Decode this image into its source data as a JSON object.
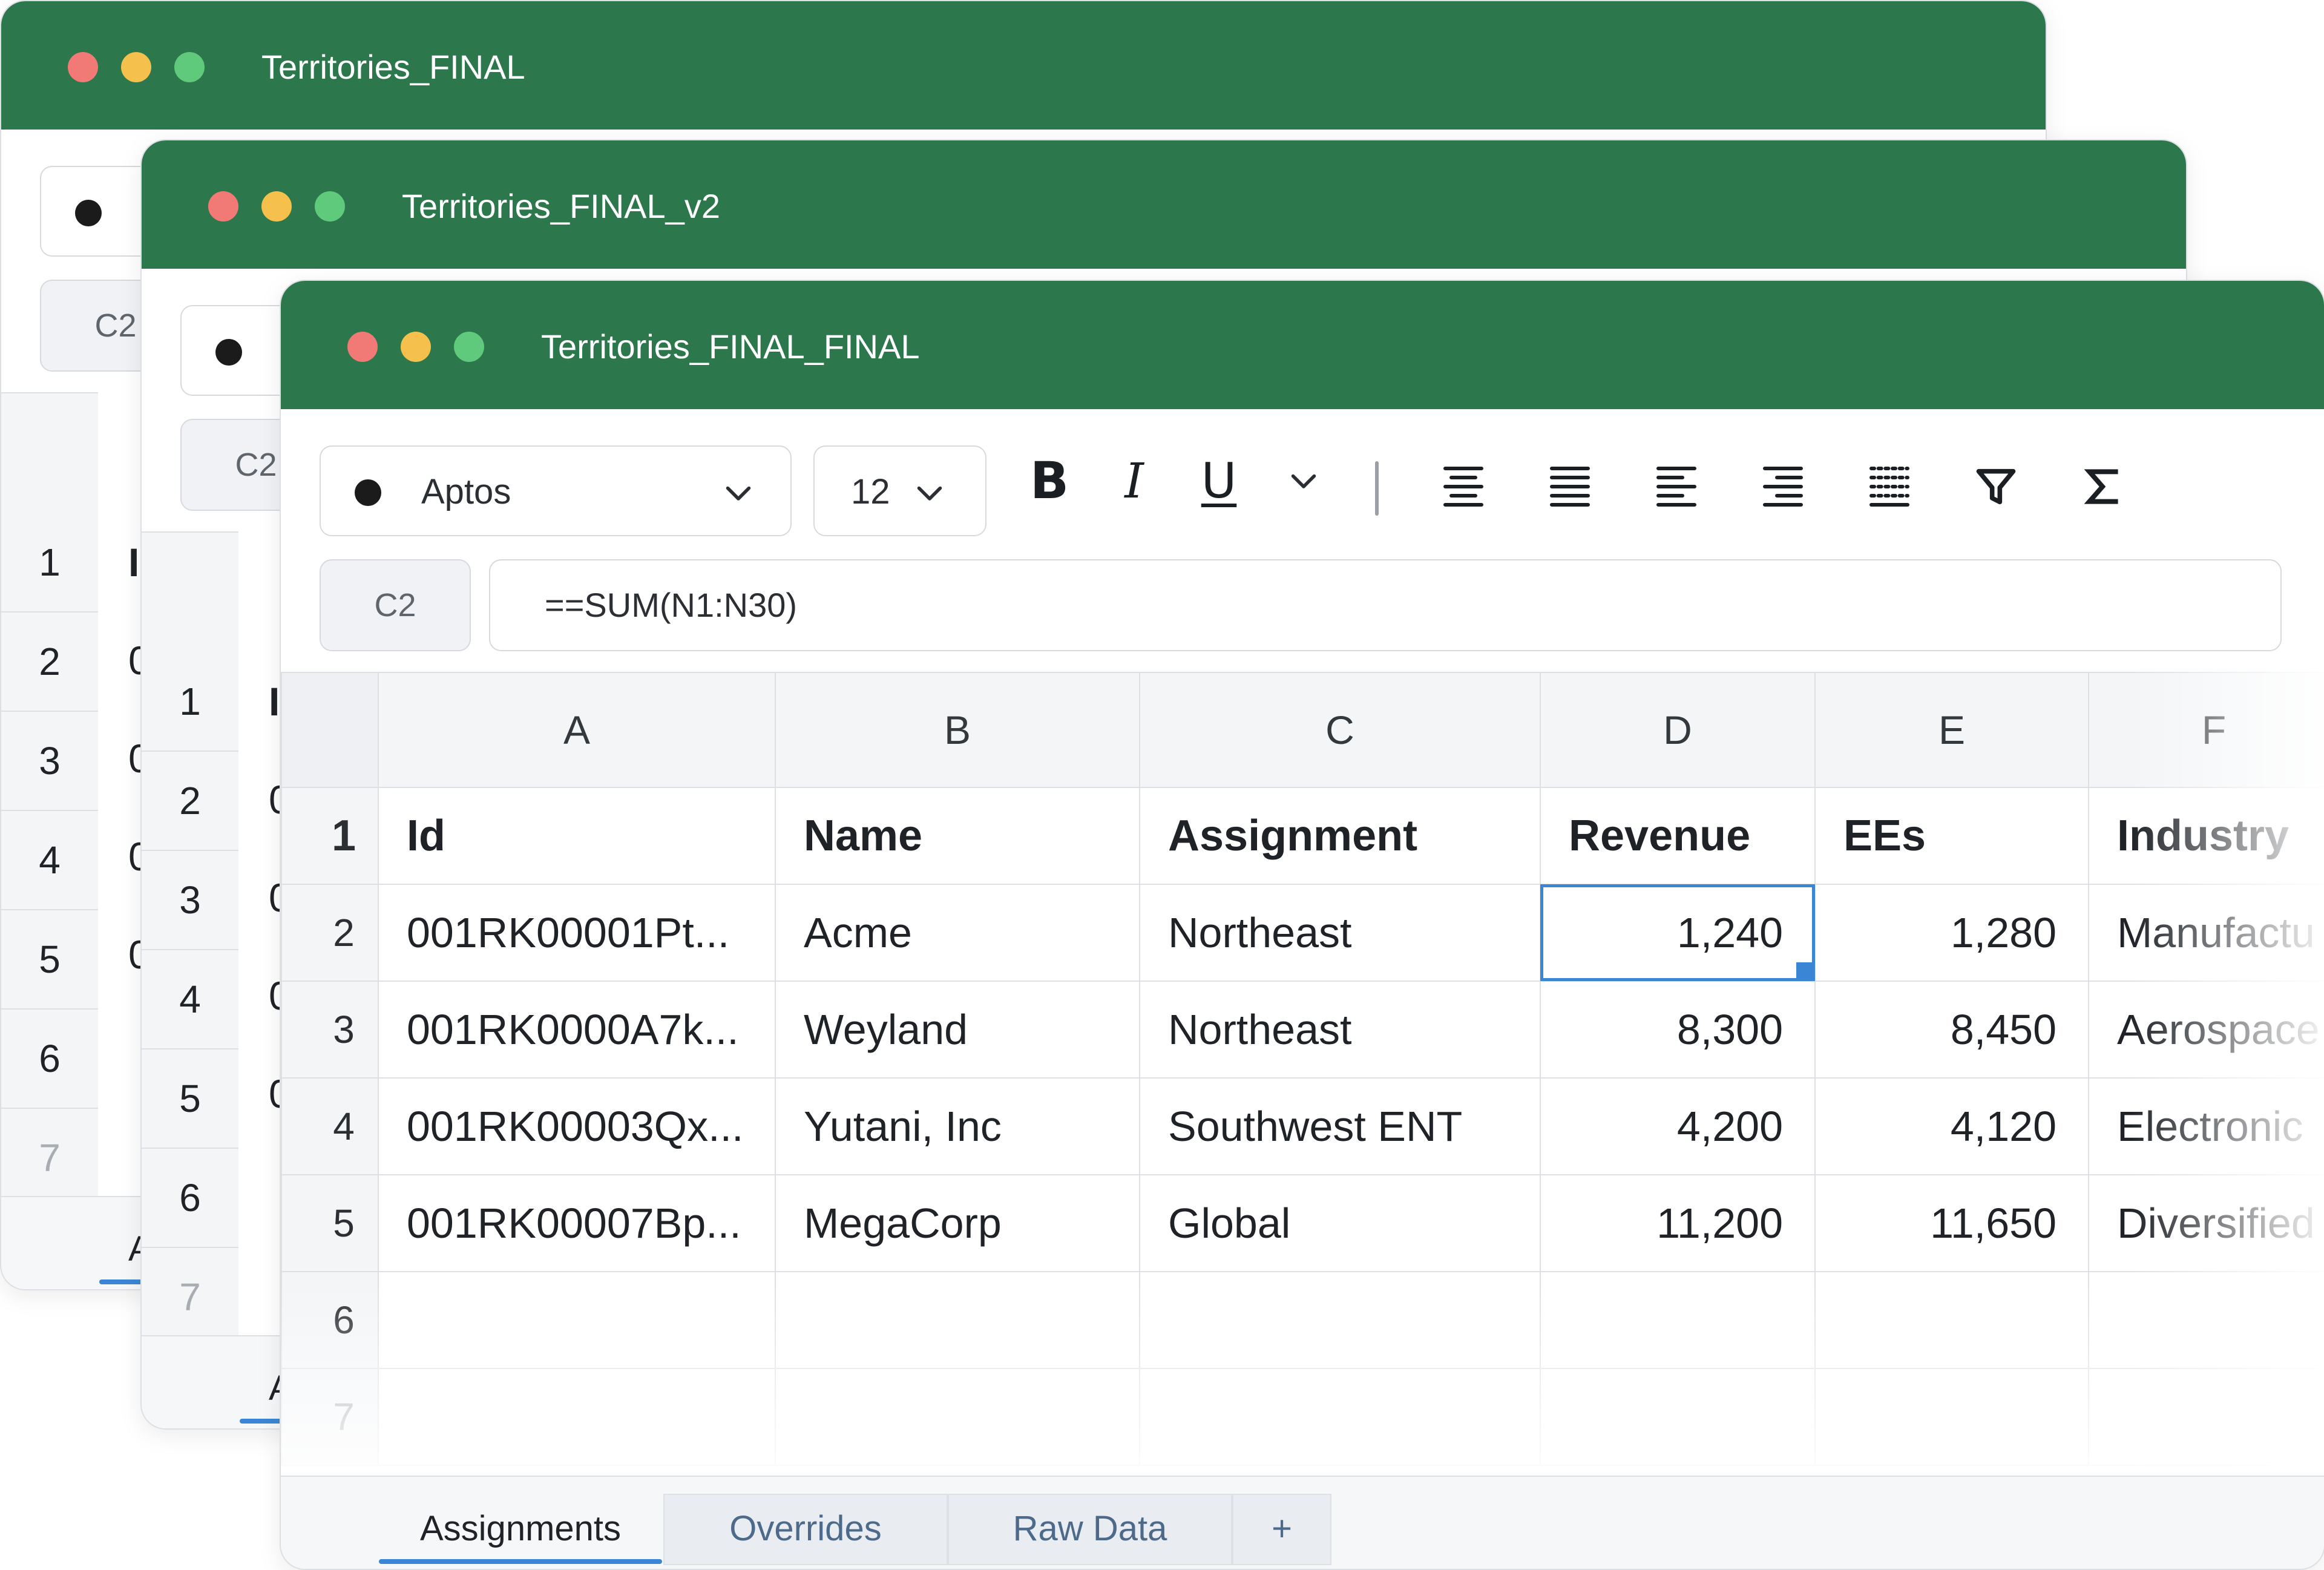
{
  "windows": [
    {
      "title": "Territories_FINAL"
    },
    {
      "title": "Territories_FINAL_v2"
    },
    {
      "title": "Territories_FINAL_FINAL"
    }
  ],
  "toolbar": {
    "font_name": "Aptos",
    "font_size": "12",
    "bold_label": "B",
    "italic_label": "I",
    "underline_label": "U"
  },
  "formula_bar": {
    "cell_ref": "C2",
    "formula": "==SUM(N1:N30)"
  },
  "back_window": {
    "cell_ref": "C2",
    "row_numbers": [
      "1",
      "2",
      "3",
      "4",
      "5",
      "6",
      "7"
    ],
    "col_peek": [
      "I",
      "0",
      "0",
      "0",
      "0"
    ],
    "tab_peek": "A"
  },
  "sheet": {
    "columns": [
      "A",
      "B",
      "C",
      "D",
      "E",
      "F"
    ],
    "header_row": {
      "row": "1",
      "cells": [
        "Id",
        "Name",
        "Assignment",
        "Revenue",
        "EEs",
        "Industry"
      ]
    },
    "rows": [
      {
        "row": "2",
        "id": "001RK00001Pt...",
        "name": "Acme",
        "assignment": "Northeast",
        "revenue": "1,240",
        "ees": "1,280",
        "industry": "Manufactu"
      },
      {
        "row": "3",
        "id": "001RK0000A7k...",
        "name": "Weyland",
        "assignment": "Northeast",
        "revenue": "8,300",
        "ees": "8,450",
        "industry": "Aerospace"
      },
      {
        "row": "4",
        "id": "001RK00003Qx...",
        "name": "Yutani, Inc",
        "assignment": "Southwest ENT",
        "revenue": "4,200",
        "ees": "4,120",
        "industry": "Electronic"
      },
      {
        "row": "5",
        "id": "001RK00007Bp...",
        "name": "MegaCorp",
        "assignment": "Global",
        "revenue": "11,200",
        "ees": "11,650",
        "industry": "Diversified"
      }
    ],
    "empty_rows": [
      "6",
      "7"
    ],
    "selected_cell": "D2"
  },
  "tabs": [
    "Assignments",
    "Overrides",
    "Raw Data",
    "+"
  ],
  "active_tab": "Assignments",
  "colors": {
    "titlebar": "#2c774b",
    "selection": "#3a86d4",
    "close": "#f27a76",
    "minimize": "#f5c04c",
    "maximize": "#5fca7c"
  }
}
